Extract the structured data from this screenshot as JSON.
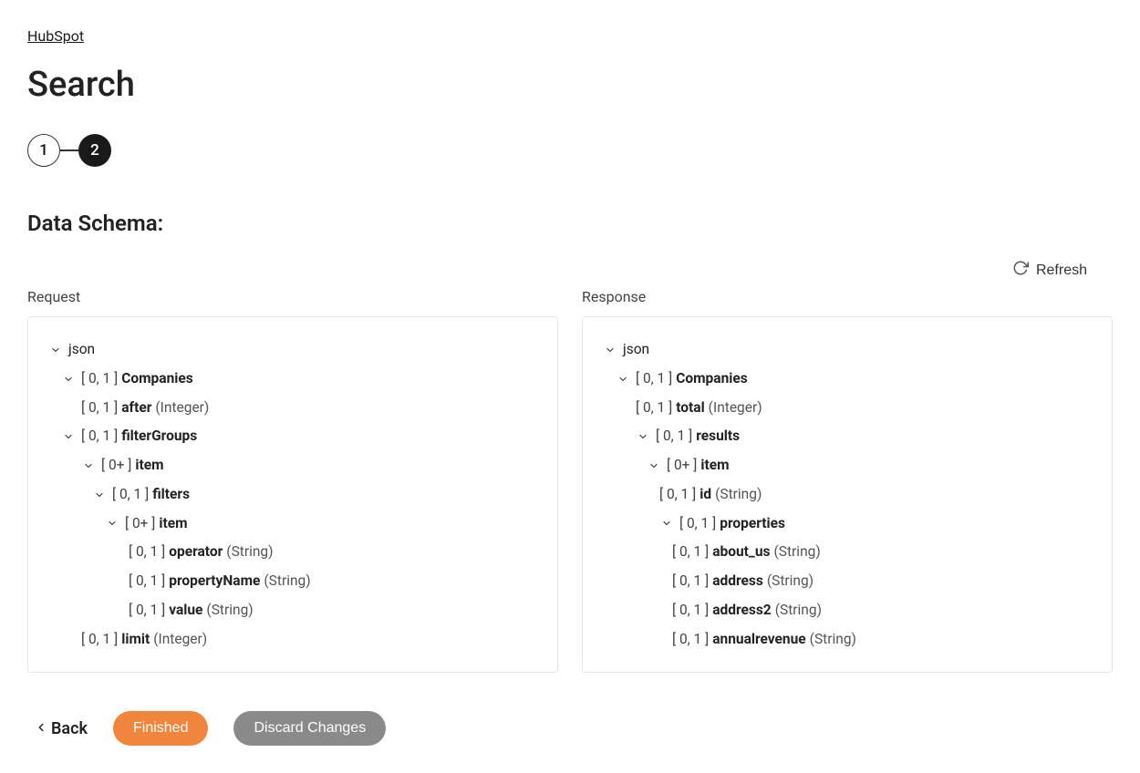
{
  "breadcrumb": {
    "label": "HubSpot"
  },
  "page_title": "Search",
  "stepper": {
    "steps": [
      "1",
      "2"
    ],
    "active": 1
  },
  "section_title": "Data Schema:",
  "refresh_label": "Refresh",
  "request_label": "Request",
  "response_label": "Response",
  "request_tree": [
    {
      "indent": 0,
      "chevron": true,
      "card": "",
      "name": "json",
      "type": "",
      "bold": false
    },
    {
      "indent": 1,
      "chevron": true,
      "card": "[ 0, 1 ]",
      "name": "Companies",
      "type": "",
      "bold": true
    },
    {
      "indent": 2,
      "chevron": false,
      "card": "[ 0, 1 ]",
      "name": "after",
      "type": "(Integer)",
      "bold": true
    },
    {
      "indent": 2,
      "chevron": true,
      "card": "[ 0, 1 ]",
      "name": "filterGroups",
      "type": "",
      "bold": true,
      "chevIndent": 1
    },
    {
      "indent": 3,
      "chevron": true,
      "card": "[ 0+ ]",
      "name": "item",
      "type": "",
      "bold": true,
      "chevIndent": 2
    },
    {
      "indent": 4,
      "chevron": true,
      "card": "[ 0, 1 ]",
      "name": "filters",
      "type": "",
      "bold": true,
      "chevIndent": 3
    },
    {
      "indent": 5,
      "chevron": true,
      "card": "[ 0+ ]",
      "name": "item",
      "type": "",
      "bold": true,
      "chevIndent": 4
    },
    {
      "indent": 6,
      "chevron": false,
      "card": "[ 0, 1 ]",
      "name": "operator",
      "type": "(String)",
      "bold": true
    },
    {
      "indent": 6,
      "chevron": false,
      "card": "[ 0, 1 ]",
      "name": "propertyName",
      "type": "(String)",
      "bold": true
    },
    {
      "indent": 6,
      "chevron": false,
      "card": "[ 0, 1 ]",
      "name": "value",
      "type": "(String)",
      "bold": true
    },
    {
      "indent": 2,
      "chevron": false,
      "card": "[ 0, 1 ]",
      "name": "limit",
      "type": "(Integer)",
      "bold": true
    }
  ],
  "response_tree": [
    {
      "indent": 0,
      "chevron": true,
      "card": "",
      "name": "json",
      "type": "",
      "bold": false
    },
    {
      "indent": 1,
      "chevron": true,
      "card": "[ 0, 1 ]",
      "name": "Companies",
      "type": "",
      "bold": true
    },
    {
      "indent": 2,
      "chevron": false,
      "card": "[ 0, 1 ]",
      "name": "total",
      "type": "(Integer)",
      "bold": true
    },
    {
      "indent": 2,
      "chevron": true,
      "card": "[ 0, 1 ]",
      "name": "results",
      "type": "",
      "bold": true
    },
    {
      "indent": 3,
      "chevron": true,
      "card": "[ 0+ ]",
      "name": "item",
      "type": "",
      "bold": true
    },
    {
      "indent": 4,
      "chevron": false,
      "card": "[ 0, 1 ]",
      "name": "id",
      "type": "(String)",
      "bold": true
    },
    {
      "indent": 4,
      "chevron": true,
      "card": "[ 0, 1 ]",
      "name": "properties",
      "type": "",
      "bold": true
    },
    {
      "indent": 5,
      "chevron": false,
      "card": "[ 0, 1 ]",
      "name": "about_us",
      "type": "(String)",
      "bold": true
    },
    {
      "indent": 5,
      "chevron": false,
      "card": "[ 0, 1 ]",
      "name": "address",
      "type": "(String)",
      "bold": true
    },
    {
      "indent": 5,
      "chevron": false,
      "card": "[ 0, 1 ]",
      "name": "address2",
      "type": "(String)",
      "bold": true
    },
    {
      "indent": 5,
      "chevron": false,
      "card": "[ 0, 1 ]",
      "name": "annualrevenue",
      "type": "(String)",
      "bold": true
    }
  ],
  "footer": {
    "back_label": "Back",
    "finished_label": "Finished",
    "discard_label": "Discard Changes"
  }
}
